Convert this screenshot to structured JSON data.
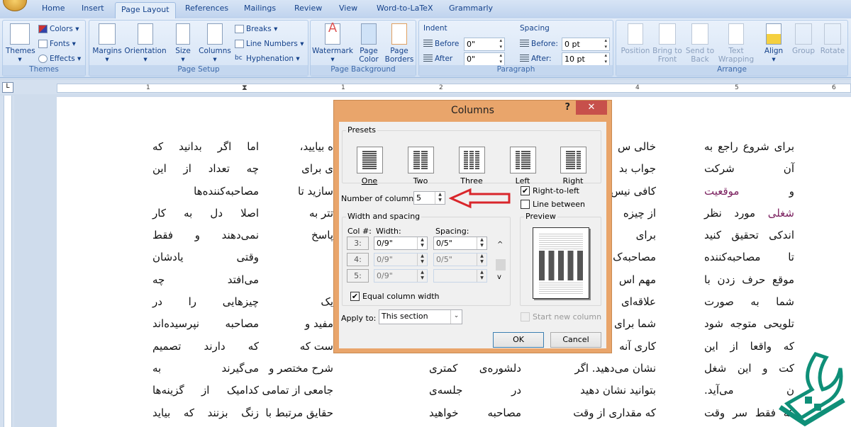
{
  "tabs": [
    {
      "label": "Home"
    },
    {
      "label": "Insert"
    },
    {
      "label": "Page Layout",
      "active": true
    },
    {
      "label": "References"
    },
    {
      "label": "Mailings"
    },
    {
      "label": "Review"
    },
    {
      "label": "View"
    },
    {
      "label": "Word-to-LaTeX"
    },
    {
      "label": "Grammarly"
    }
  ],
  "ribbon": {
    "themes": {
      "label": "Themes",
      "themes": "Themes",
      "colors": "Colors",
      "fonts": "Fonts",
      "effects": "Effects"
    },
    "page_setup": {
      "label": "Page Setup",
      "margins": "Margins",
      "orientation": "Orientation",
      "size": "Size",
      "columns": "Columns",
      "breaks": "Breaks",
      "line_numbers": "Line Numbers",
      "hyphenation": "Hyphenation"
    },
    "page_background": {
      "label": "Page Background",
      "watermark": "Watermark",
      "page_color": "Page Color",
      "page_borders": "Page Borders"
    },
    "paragraph": {
      "label": "Paragraph",
      "indent": "Indent",
      "before": "Before",
      "after": "After",
      "indent_before": "0\"",
      "indent_after": "0\"",
      "spacing": "Spacing",
      "sp_before": "Before:",
      "sp_after": "After:",
      "spacing_before": "0 pt",
      "spacing_after": "10 pt"
    },
    "arrange": {
      "label": "Arrange",
      "position": "Position",
      "bring_front": "Bring to Front",
      "send_back": "Send to Back",
      "text_wrapping": "Text Wrapping",
      "align": "Align",
      "group": "Group",
      "rotate": "Rotate"
    }
  },
  "ruler": {
    "labels": [
      "1",
      "1",
      "2",
      "4",
      "5",
      "6"
    ]
  },
  "document": {
    "col1": [
      "اما اگر بدانید که",
      "چه تعداد از این",
      "مصاحبه‌کننده‌ها",
      "اصلا دل به کار",
      "نمی‌دهند و فقط",
      "وقتی یادشان",
      "می‌افتد چه",
      "چیزهایی را در",
      "مصاحبه نپرسیده‌اند",
      "که دارند تصمیم",
      "می‌گیرند به",
      "کدامیک از گزینه‌ها",
      "زنگ بزنند که بیاید"
    ],
    "col2": [
      "ه بیایید،",
      "ی برای",
      "سازید تا",
      "تتر به",
      "پاسخ",
      "",
      "",
      "یک",
      "مفید و",
      "ست که",
      "شرح مختصر و",
      "جامعی از تمامی",
      "حقایق مرتبط با"
    ],
    "col3": [
      "دلشوره‌ی کمتری",
      "در جلسه‌ی",
      "مصاحبه خواهید"
    ],
    "col4": [
      "خالی س",
      "جواب بد",
      "کافی نیس",
      "از چیزه",
      "برای",
      "مصاحبه‌ک",
      "مهم اس",
      "علاقه‌ای",
      "شما برای",
      "کاری آنه",
      "نشان می‌دهید. اگر",
      "بتوانید نشان دهید",
      "که مقداری از وقت"
    ],
    "col5": [
      "برای شروع راجع به",
      "آن شرکت",
      "و موقعیت",
      "شغلی مورد نظر",
      "اندکی تحقیق کنید",
      "تا مصاحبه‌کننده",
      "موقع حرف زدن با",
      "شما به صورت",
      "تلویحی متوجه شود",
      "که واقعا از این",
      "کت و این شغل",
      "ن می‌آید.",
      "که فقط سر وقت"
    ]
  },
  "dialog": {
    "title": "Columns",
    "help": "?",
    "close": "✕",
    "presets_label": "Presets",
    "presets": [
      {
        "label": "One"
      },
      {
        "label": "Two"
      },
      {
        "label": "Three"
      },
      {
        "label": "Left"
      },
      {
        "label": "Right"
      }
    ],
    "num_columns_label": "Number of columns:",
    "num_columns": "5",
    "right_to_left": {
      "label": "Right-to-left",
      "checked": true
    },
    "line_between": {
      "label": "Line between",
      "checked": false
    },
    "width_spacing_label": "Width and spacing",
    "col_header": "Col #:",
    "width_header": "Width:",
    "spacing_header": "Spacing:",
    "rows": [
      {
        "col": "3:",
        "width": "0/9\"",
        "spacing": "0/5\""
      },
      {
        "col": "4:",
        "width": "0/9\"",
        "spacing": "0/5\""
      },
      {
        "col": "5:",
        "width": "0/9\"",
        "spacing": ""
      }
    ],
    "equal_width": {
      "label": "Equal column width",
      "checked": true
    },
    "preview_label": "Preview",
    "apply_to_label": "Apply to:",
    "apply_to": "This section",
    "start_new_column": {
      "label": "Start new column",
      "checked": false
    },
    "ok": "OK",
    "cancel": "Cancel",
    "arrow_color": "#d9262b"
  },
  "colors": {
    "dialog_frame": "#e9a56b",
    "close_button": "#c7504b",
    "logo": "#0f8f78"
  }
}
